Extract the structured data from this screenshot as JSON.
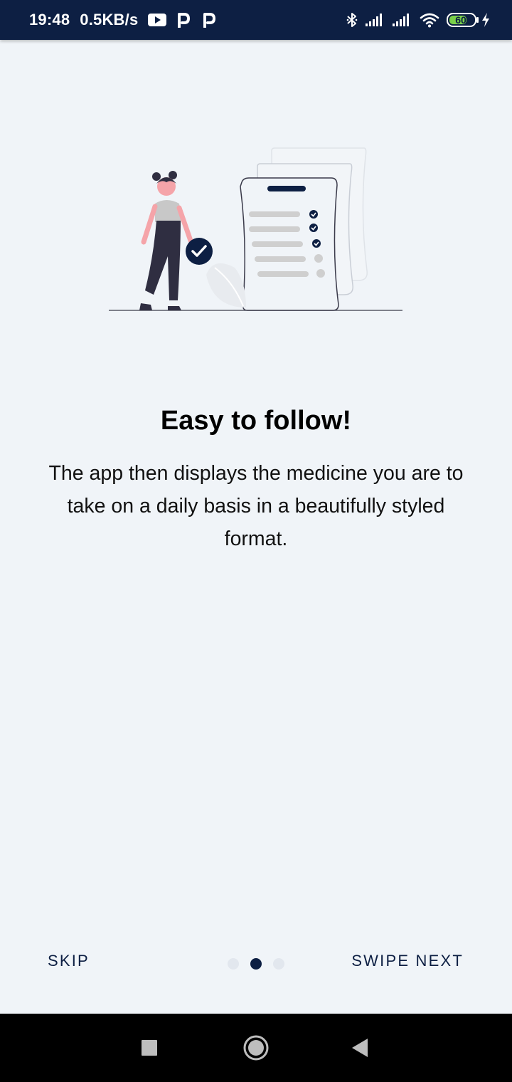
{
  "status_bar": {
    "time": "19:48",
    "network_speed": "0.5KB/s",
    "battery_level": "60",
    "icons": [
      "youtube-icon",
      "p-app-icon",
      "p-app-icon",
      "bluetooth-icon",
      "signal-icon",
      "signal-icon",
      "wifi-icon",
      "battery-icon",
      "charging-icon"
    ]
  },
  "onboarding": {
    "title": "Easy to follow!",
    "description": "The app then displays the medicine you are to take on a daily basis in a beautifully styled format.",
    "skip_label": "SKIP",
    "next_label": "SWIPE NEXT",
    "page_indicator": {
      "total": 3,
      "current": 2
    }
  },
  "nav_bar": {
    "buttons": [
      "recents-button",
      "home-button",
      "back-button"
    ]
  },
  "colors": {
    "status_bar": "#0d1f43",
    "background": "#f0f4f8",
    "accent": "#0d1f43",
    "dot_inactive": "#e2e7ee",
    "battery_fill": "#7ad04a"
  }
}
